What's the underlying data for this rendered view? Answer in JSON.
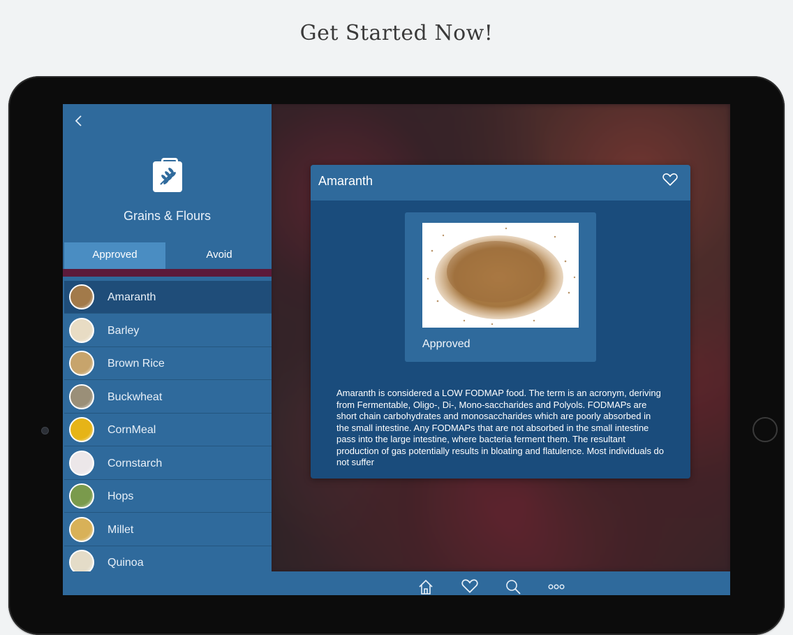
{
  "headline": "Get Started Now!",
  "sidebar": {
    "category_title": "Grains & Flours",
    "category_icon": "wheat-bag-icon",
    "tabs": [
      {
        "label": "Approved",
        "selected": true
      },
      {
        "label": "Avoid",
        "selected": false
      }
    ],
    "items": [
      {
        "label": "Amaranth",
        "color": "#a27a4a",
        "selected": true
      },
      {
        "label": "Barley",
        "color": "#e8dcc4",
        "selected": false
      },
      {
        "label": "Brown Rice",
        "color": "#c7a46c",
        "selected": false
      },
      {
        "label": "Buckwheat",
        "color": "#9a8f78",
        "selected": false
      },
      {
        "label": "CornMeal",
        "color": "#e6b417",
        "selected": false
      },
      {
        "label": "Cornstarch",
        "color": "#ece7e9",
        "selected": false
      },
      {
        "label": "Hops",
        "color": "#7a9a4c",
        "selected": false
      },
      {
        "label": "Millet",
        "color": "#d8b158",
        "selected": false
      },
      {
        "label": "Quinoa",
        "color": "#e4dcc8",
        "selected": false
      }
    ]
  },
  "detail": {
    "title": "Amaranth",
    "status": "Approved",
    "description": "Amaranth is considered a LOW FODMAP food. The term is an acronym, deriving from Fermentable, Oligo-, Di-, Mono-saccharides and Polyols. FODMAPs are short chain carbohydrates and monosaccharides which are poorly absorbed in the small intestine. Any FODMAPs that are not absorbed in the small intestine pass into the large intestine, where bacteria ferment them. The resultant production of gas potentially results in bloating and flatulence. Most individuals do not suffer"
  },
  "bottom_bar": {
    "icons": [
      "home-icon",
      "heart-icon",
      "search-icon",
      "more-icon"
    ]
  },
  "colors": {
    "primary": "#2f6a9c",
    "selected_row": "#1f4d79",
    "tab_active": "#4a8dc2",
    "tab_strip": "#5c1a3a",
    "card": "#1a4c7c"
  }
}
